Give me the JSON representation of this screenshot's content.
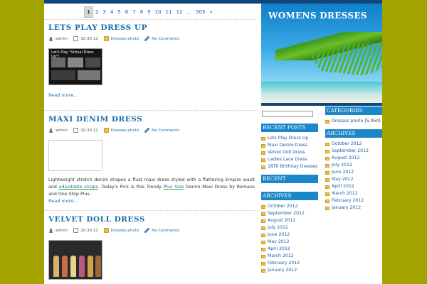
{
  "pagination": {
    "current": "1",
    "pages": [
      "2",
      "3",
      "4",
      "5",
      "6",
      "7",
      "8",
      "9",
      "10",
      "11",
      "12"
    ],
    "ellipsis": "...",
    "last": "505",
    "next": "»"
  },
  "posts": [
    {
      "title": "LETS PLAY DRESS UP",
      "author": "admin",
      "date": "10.30.12",
      "category": "Dresses photo",
      "comments": "No Comments",
      "image_caption": "Let's Play \"Virtual Dress Up\"!",
      "read_more": "Read more..."
    },
    {
      "title": "MAXI DENIM DRESS",
      "author": "admin",
      "date": "10.30.12",
      "category": "Dresses photo",
      "comments": "No Comments",
      "excerpt_1": "Lightweight stretch denim shapes a fluid maxi dress styled with a flattering Empire waist and ",
      "excerpt_link_1": "adjustable straps",
      "excerpt_2": ". Today's Pick is this Trendy ",
      "excerpt_link_2": "Plus Size",
      "excerpt_3": " Denim Maxi Dress by Romans and One Stop Plus.",
      "read_more": "Read more..."
    },
    {
      "title": "VELVET DOLL DRESS",
      "author": "admin",
      "date": "10.30.12",
      "category": "Dresses photo",
      "comments": "No Comments"
    }
  ],
  "site": {
    "title": "WOMENS DRESSES"
  },
  "sidebar_left": {
    "recent_posts_title": "RECENT POSTS",
    "recent_posts": [
      "Lets Play Dress Up",
      "Maxi Denim Dress",
      "Velvet Doll Dress",
      "Ladies Lace Dress",
      "18Th Birthday Dresses"
    ],
    "recent_comments_title": "RECENT COMMENTS",
    "archives_title": "ARCHIVES",
    "archives": [
      "October 2012",
      "September 2012",
      "August 2012",
      "July 2012",
      "June 2012",
      "May 2012",
      "April 2012",
      "March 2012",
      "February 2012",
      "January 2012"
    ]
  },
  "sidebar_right": {
    "categories_title": "CATEGORIES",
    "categories": [
      {
        "name": "Dresses photo",
        "count": "(5,050)"
      }
    ],
    "archives_title": "ARCHIVES",
    "archives": [
      "October 2012",
      "September 2012",
      "August 2012",
      "July 2012",
      "June 2012",
      "May 2012",
      "April 2012",
      "March 2012",
      "February 2012",
      "January 2012"
    ]
  },
  "colors": {
    "page_background": "#a3a300",
    "accent_blue": "#1a87c8",
    "navy": "#12467a",
    "link": "#1a6fa8"
  }
}
